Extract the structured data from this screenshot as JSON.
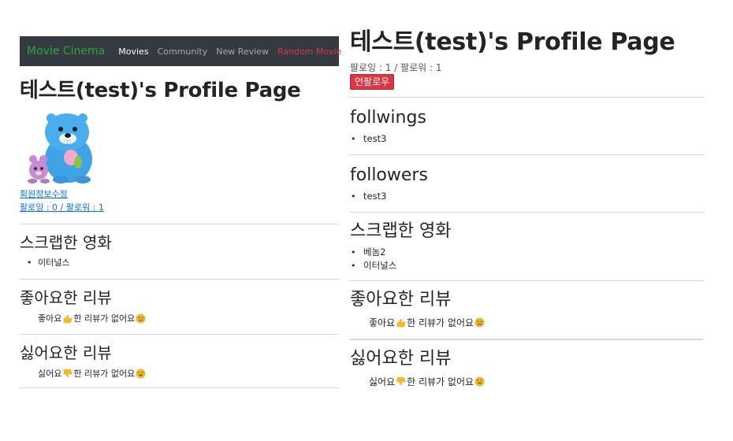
{
  "left": {
    "navbar": {
      "brand": "Movie Cinema",
      "items": [
        {
          "label": "Movies"
        },
        {
          "label": "Community"
        },
        {
          "label": "New Review"
        },
        {
          "label": "Random Movie"
        }
      ]
    },
    "title": "테스트(test)'s Profile Page",
    "edit_link": "회원정보수정",
    "follow_counts": "팔로잉 : 0 / 팔로워 : 1",
    "scrapped": {
      "heading": "스크랩한 영화",
      "items": [
        "이터널스"
      ]
    },
    "liked": {
      "heading": "좋아요한 리뷰",
      "empty_prefix": "좋아요",
      "empty_suffix": "한 리뷰가 없어요"
    },
    "disliked": {
      "heading": "싫어요한 리뷰",
      "empty_prefix": "싫어요",
      "empty_suffix": "한 리뷰가 없어요"
    }
  },
  "right": {
    "title": "테스트(test)'s Profile Page",
    "follow_counts": "팔로잉 : 1 / 팔로워 : 1",
    "unfollow_label": "언팔로우",
    "followings": {
      "heading": "follwings",
      "items": [
        "test3"
      ]
    },
    "followers": {
      "heading": "followers",
      "items": [
        "test3"
      ]
    },
    "scrapped": {
      "heading": "스크랩한 영화",
      "items": [
        "베놈2",
        "이터널스"
      ]
    },
    "liked": {
      "heading": "좋아요한 리뷰",
      "empty_prefix": "좋아요",
      "empty_suffix": "한 리뷰가 없어요"
    },
    "disliked": {
      "heading": "싫어요한 리뷰",
      "empty_prefix": "싫어요",
      "empty_suffix": "한 리뷰가 없어요"
    }
  },
  "colors": {
    "navbar_bg": "#343a40",
    "brand": "#28a745",
    "danger": "#dc3545",
    "link": "#0d6efd"
  },
  "icons": {
    "thumbs_up": "thumbs-up-icon",
    "thumbs_down": "thumbs-down-icon",
    "sad_face": "sad-face-icon",
    "smile_face": "smile-face-icon"
  }
}
